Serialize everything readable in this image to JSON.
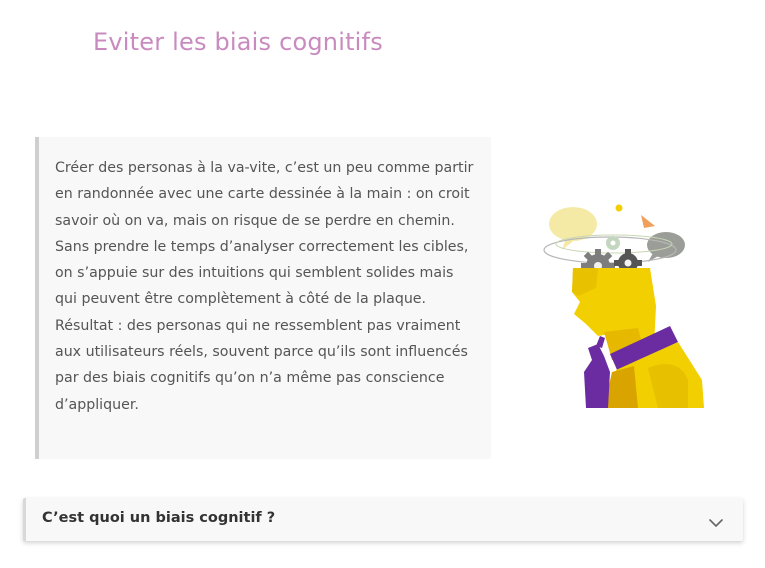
{
  "section": {
    "title": "Eviter les biais cognitifs"
  },
  "quote": {
    "text": "Créer des personas à la va-vite, c’est un peu comme partir en randonnée avec une carte dessinée à la main : on croit savoir où on va, mais on risque de se perdre en chemin. Sans prendre le temps d’analyser correctement les cibles, on s’appuie sur des intuitions qui semblent solides mais qui peuvent être complètement à côté de la plaque. Résultat : des personas qui ne ressemblent pas vraiment aux utilisateurs réels, souvent parce qu’ils sont influencés par des biais cognitifs qu’on n’a même pas conscience d’appliquer."
  },
  "illustration": {
    "icon": "thinking-head-illustration",
    "colors": {
      "skin": "#f2cf00",
      "collar": "#6a2ca0",
      "hand": "#6a2ca0",
      "bubble_yellow": "#f5eaa5",
      "bubble_grey": "#9b9e98",
      "gear": "#7d7d7d"
    }
  },
  "accordion": {
    "label": "C’est quoi un biais cognitif ?",
    "icon": "chevron-down-icon",
    "expanded": false
  }
}
